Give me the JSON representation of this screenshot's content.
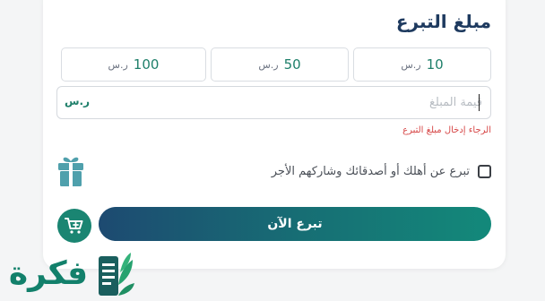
{
  "form": {
    "title": "مبلغ التبرع",
    "amounts": [
      {
        "value": "10",
        "currency": "ر.س"
      },
      {
        "value": "50",
        "currency": "ر.س"
      },
      {
        "value": "100",
        "currency": "ر.س"
      }
    ],
    "amount_input": {
      "placeholder": "قيمة المبلغ",
      "value": "",
      "currency": "ر.س"
    },
    "error": "الرجاء إدخال مبلغ التبرع",
    "share": {
      "label": "تبرع عن أهلك أو أصدقائك وشاركهم الأجر",
      "checked": false
    },
    "donate_label": "تبرع الآن",
    "icons": {
      "gift": "gift-icon",
      "cart": "add-to-cart-icon"
    }
  },
  "watermark": {
    "text": "فكرة"
  },
  "colors": {
    "accent": "#1a8572",
    "title": "#1e3a5f",
    "error": "#d64545",
    "gradient_start": "#1d4a71",
    "gradient_end": "#13897a"
  }
}
